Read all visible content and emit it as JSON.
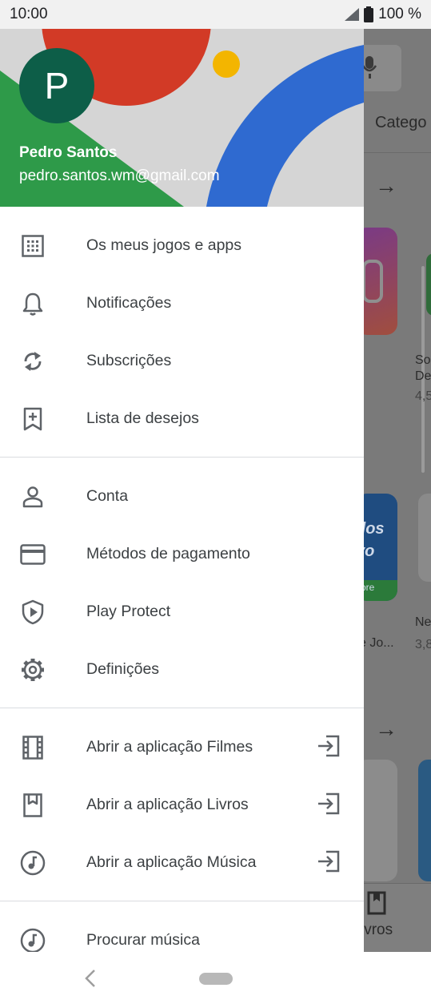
{
  "status_bar": {
    "time": "10:00",
    "battery": "100 %"
  },
  "background_app": {
    "tab_partial": "Catego",
    "text_items": [
      "So",
      "De",
      "4,5",
      "Ne",
      "3,8",
      "e Jo..."
    ],
    "tile_text": [
      "dos",
      "vo",
      "ore"
    ],
    "bottom_nav_label": "ivros"
  },
  "drawer": {
    "header": {
      "avatar_letter": "P",
      "name": "Pedro Santos",
      "email": "pedro.santos.wm@gmail.com"
    },
    "section1": [
      {
        "label": "Os meus jogos e apps",
        "icon": "apps-grid-icon"
      },
      {
        "label": "Notificações",
        "icon": "bell-icon"
      },
      {
        "label": "Subscrições",
        "icon": "refresh-icon"
      },
      {
        "label": "Lista de desejos",
        "icon": "bookmark-add-icon"
      }
    ],
    "section2": [
      {
        "label": "Conta",
        "icon": "person-icon"
      },
      {
        "label": "Métodos de pagamento",
        "icon": "credit-card-icon"
      },
      {
        "label": "Play Protect",
        "icon": "shield-play-icon"
      },
      {
        "label": "Definições",
        "icon": "gear-icon"
      }
    ],
    "section3": [
      {
        "label": "Abrir a aplicação Filmes",
        "icon": "film-icon"
      },
      {
        "label": "Abrir a aplicação Livros",
        "icon": "book-icon"
      },
      {
        "label": "Abrir a aplicação Música",
        "icon": "music-note-icon"
      }
    ],
    "section4": [
      {
        "label": "Procurar música",
        "icon": "music-note-icon"
      }
    ]
  },
  "colors": {
    "avatar": "#0d5e48",
    "header_red": "#d23a26",
    "header_green": "#2e9a49",
    "header_blue": "#2f6ad0",
    "header_yellow": "#f3b500"
  }
}
